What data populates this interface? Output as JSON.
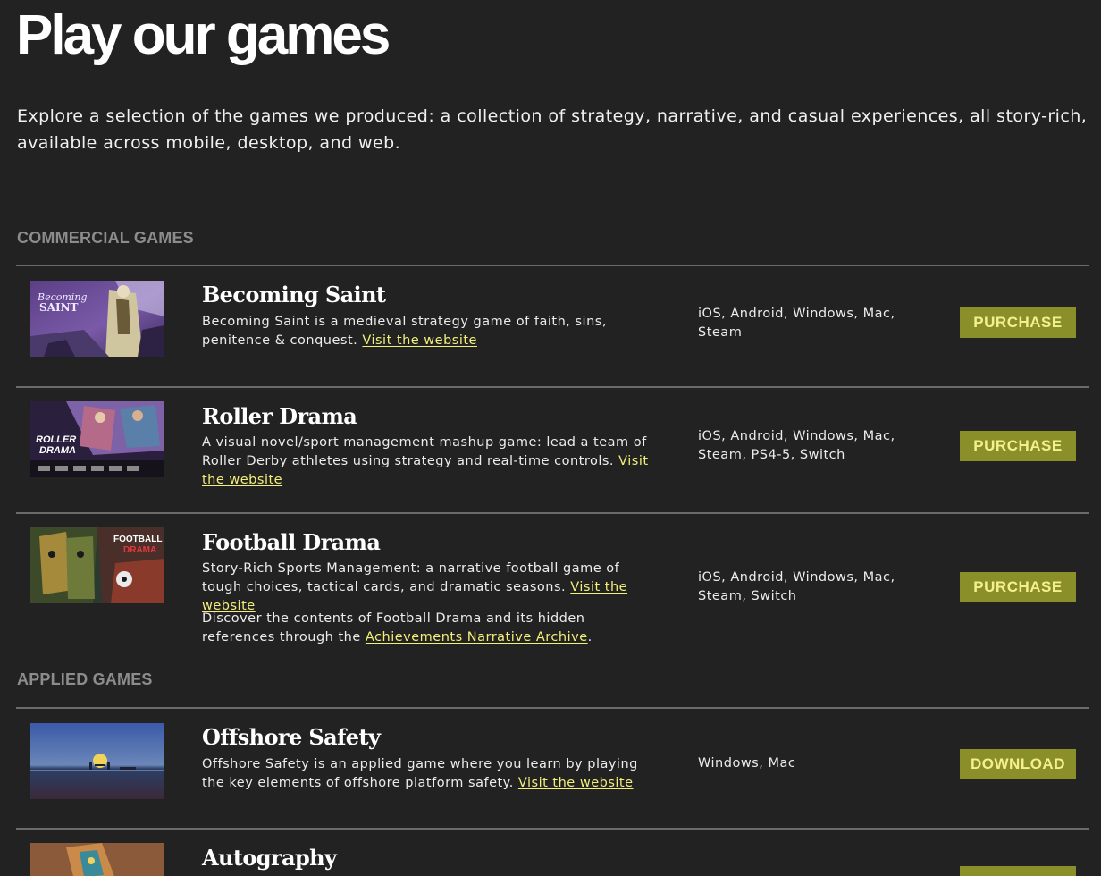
{
  "page": {
    "title": "Play our games",
    "intro": "Explore a selection of the games we produced: a collection of strategy, narrative, and casual experiences, all story-rich, available across mobile, desktop, and web."
  },
  "sections": {
    "commercial": {
      "heading": "COMMERCIAL GAMES",
      "games": [
        {
          "name": "Becoming Saint",
          "description": "Becoming Saint is a medieval strategy game of faith, sins, penitence & conquest.",
          "link_text": "Visit the website",
          "platforms": "iOS, Android, Windows, Mac, Steam",
          "button": "PURCHASE",
          "thumb_text": [
            "Becoming",
            "SAINT"
          ]
        },
        {
          "name": "Roller Drama",
          "description": "A visual novel/sport management mashup game: lead a team of Roller Derby athletes using strategy and real-time controls.",
          "link_text": "Visit the website",
          "platforms": "iOS, Android, Windows, Mac, Steam, PS4-5, Switch",
          "button": "PURCHASE",
          "thumb_text": [
            "ROLLER",
            "DRAMA"
          ]
        },
        {
          "name": "Football Drama",
          "description": "Story-Rich Sports Management: a narrative football game of tough choices, tactical cards, and dramatic seasons.",
          "link_text": "Visit the website",
          "extra_prefix": "Discover the contents of Football Drama and its hidden references through the",
          "extra_link": "Achievements Narrative Archive",
          "extra_suffix": ".",
          "platforms": "iOS, Android, Windows, Mac, Steam, Switch",
          "button": "PURCHASE",
          "thumb_text": [
            "FOOTBALL",
            "DRAMA"
          ]
        }
      ]
    },
    "applied": {
      "heading": "APPLIED GAMES",
      "games": [
        {
          "name": "Offshore Safety",
          "description": "Offshore Safety is an applied game where you learn by playing the key elements of offshore platform safety.",
          "link_text": "Visit the website",
          "platforms": "Windows, Mac",
          "button": "DOWNLOAD"
        },
        {
          "name": "Autography"
        }
      ]
    }
  },
  "colors": {
    "background": "#222222",
    "accent_button": "#8a8f2a",
    "button_text": "#f4f18c",
    "link": "#f2ef7a",
    "divider": "#6a6a6a",
    "section_heading": "#8c8c8c"
  }
}
